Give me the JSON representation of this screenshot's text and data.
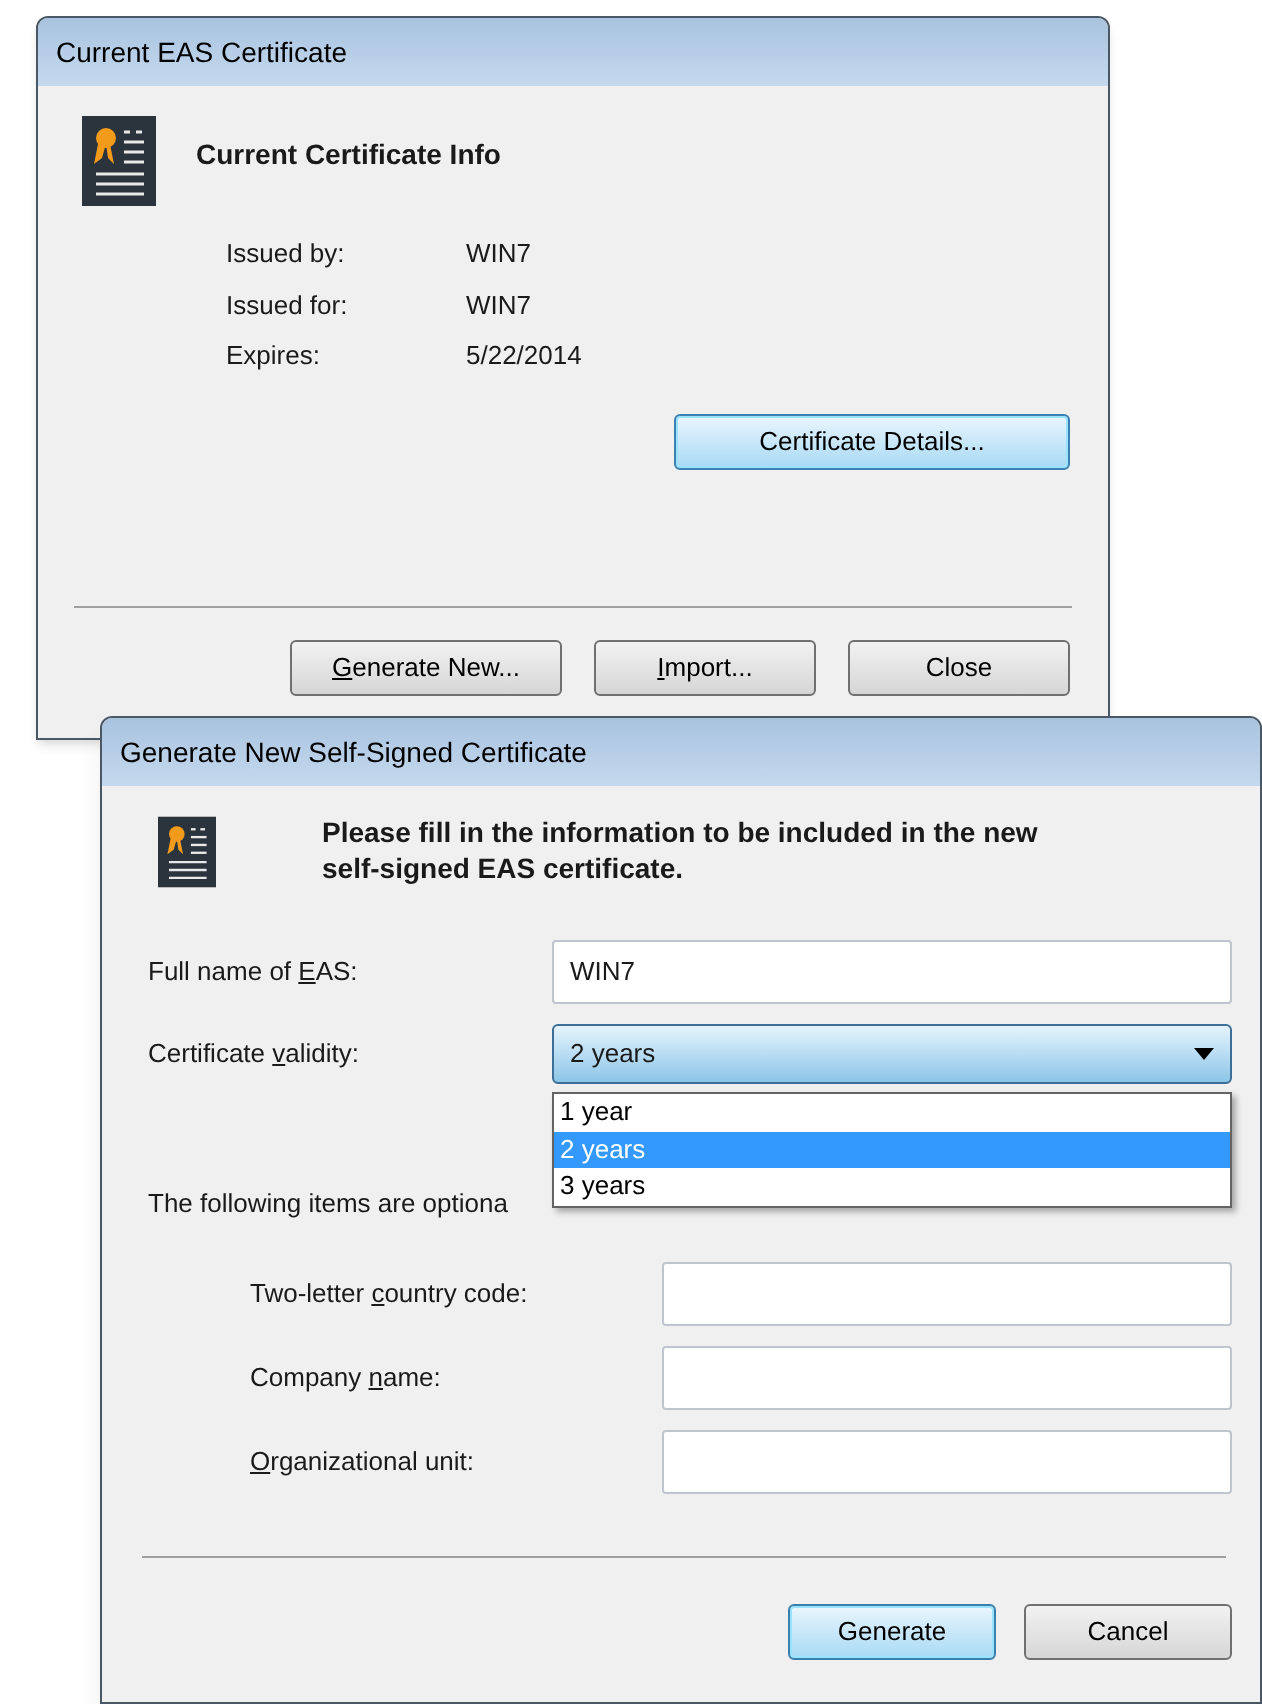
{
  "certificate_window": {
    "title": "Current EAS Certificate",
    "heading": "Current Certificate Info",
    "info": [
      {
        "label": "Issued by:",
        "value": "WIN7"
      },
      {
        "label": "Issued for:",
        "value": "WIN7"
      },
      {
        "label": "Expires:",
        "value": "5/22/2014"
      }
    ],
    "details_button": {
      "label": [
        {
          "text": "Certificate Details...",
          "underlined": false
        }
      ],
      "default": true
    },
    "buttons": [
      {
        "label": [
          {
            "text": "G",
            "underlined": true
          },
          {
            "text": "enerate New...",
            "underlined": false
          }
        ],
        "default": false
      },
      {
        "label": [
          {
            "text": "I",
            "underlined": true
          },
          {
            "text": "mport...",
            "underlined": false
          }
        ],
        "default": false
      },
      {
        "label": [
          {
            "text": "Close",
            "underlined": false
          }
        ],
        "default": false
      }
    ]
  },
  "generate_window": {
    "title": "Generate New Self-Signed Certificate",
    "heading": "Please fill in the information to be included in the new self-signed EAS certificate.",
    "full_name": {
      "label": [
        {
          "text": "Full name of ",
          "underlined": false
        },
        {
          "text": "E",
          "underlined": true
        },
        {
          "text": "AS:",
          "underlined": false
        }
      ],
      "value": "WIN7"
    },
    "validity": {
      "label": [
        {
          "text": "Certificate ",
          "underlined": false
        },
        {
          "text": "v",
          "underlined": true
        },
        {
          "text": "alidity:",
          "underlined": false
        }
      ],
      "value": "2 years",
      "expanded": true,
      "options": [
        {
          "label": "1 year",
          "selected": false
        },
        {
          "label": "2 years",
          "selected": true
        },
        {
          "label": "3 years",
          "selected": false
        }
      ]
    },
    "optional_note": "The following items are optiona",
    "optional_fields": [
      {
        "label": [
          {
            "text": "Two-letter ",
            "underlined": false
          },
          {
            "text": "c",
            "underlined": true
          },
          {
            "text": "ountry code:",
            "underlined": false
          }
        ]
      },
      {
        "label": [
          {
            "text": "Company ",
            "underlined": false
          },
          {
            "text": "n",
            "underlined": true
          },
          {
            "text": "ame:",
            "underlined": false
          }
        ]
      },
      {
        "label": [
          {
            "text": "O",
            "underlined": true
          },
          {
            "text": "rganizational unit:",
            "underlined": false
          }
        ]
      }
    ],
    "buttons": [
      {
        "label": [
          {
            "text": "Generate",
            "underlined": false
          }
        ],
        "default": true
      },
      {
        "label": [
          {
            "text": "Cancel",
            "underlined": false
          }
        ],
        "default": false
      }
    ]
  }
}
